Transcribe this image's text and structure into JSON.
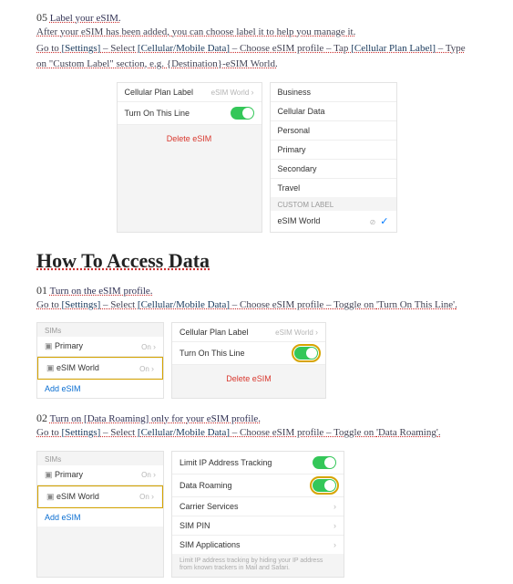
{
  "step05": {
    "num": "05",
    "title": "Label your eSIM.",
    "line1_a": "After your eSIM has been added, you can choose label it to help you manage it.",
    "line2_a": "Go to ",
    "line2_b": "[Settings]",
    "line2_c": " – Select ",
    "line2_d": "[Cellular/Mobile Data]",
    "line2_e": " – Choose eSIM profile – Tap ",
    "line2_f": "[Cellular Plan Label]",
    "line2_g": " – Type",
    "line3": "on \"Custom Label\" section, e.g. {Destination}-eSIM World."
  },
  "mock1": {
    "left": {
      "cell_label": "Cellular Plan Label",
      "cell_value": "eSIM World",
      "turn_on": "Turn On This Line",
      "delete": "Delete eSIM"
    },
    "right": {
      "items": [
        "Business",
        "Cellular Data",
        "Personal",
        "Primary",
        "Secondary",
        "Travel"
      ],
      "custom_hdr": "CUSTOM LABEL",
      "custom_val": "eSIM World"
    }
  },
  "heading2": "How To Access Data",
  "step01": {
    "num": "01",
    "title": "Turn on the eSIM profile.",
    "line_a": "Go to ",
    "line_b": "[Settings]",
    "line_c": " – Select ",
    "line_d": "[Cellular/Mobile Data]",
    "line_e": " – Choose eSIM profile – Toggle on ",
    "line_f": "'Turn On This Line'",
    "line_g": "."
  },
  "mock2": {
    "left": {
      "hdr": "SIMs",
      "primary": "Primary",
      "primary_state": "On",
      "esim": "eSIM World",
      "esim_state": "On",
      "add": "Add eSIM"
    },
    "right": {
      "cpl": "Cellular Plan Label",
      "cpl_val": "eSIM World",
      "turnon": "Turn On This Line",
      "delete": "Delete eSIM"
    }
  },
  "step02": {
    "num": "02",
    "title": "Turn on [Data Roaming] only for your eSIM profile.",
    "line_a": "Go to ",
    "line_b": "[Settings]",
    "line_c": " – Select ",
    "line_d": "[Cellular/Mobile Data]",
    "line_e": " – Choose eSIM profile – Toggle on ",
    "line_f": "'Data Roaming'",
    "line_g": "."
  },
  "mock3": {
    "right": {
      "limit": "Limit IP Address Tracking",
      "roam": "Data Roaming",
      "carrier": "Carrier Services",
      "simpin": "SIM PIN",
      "simapps": "SIM Applications",
      "note": "Limit IP address tracking by hiding your IP address from known trackers in Mail and Safari."
    }
  }
}
